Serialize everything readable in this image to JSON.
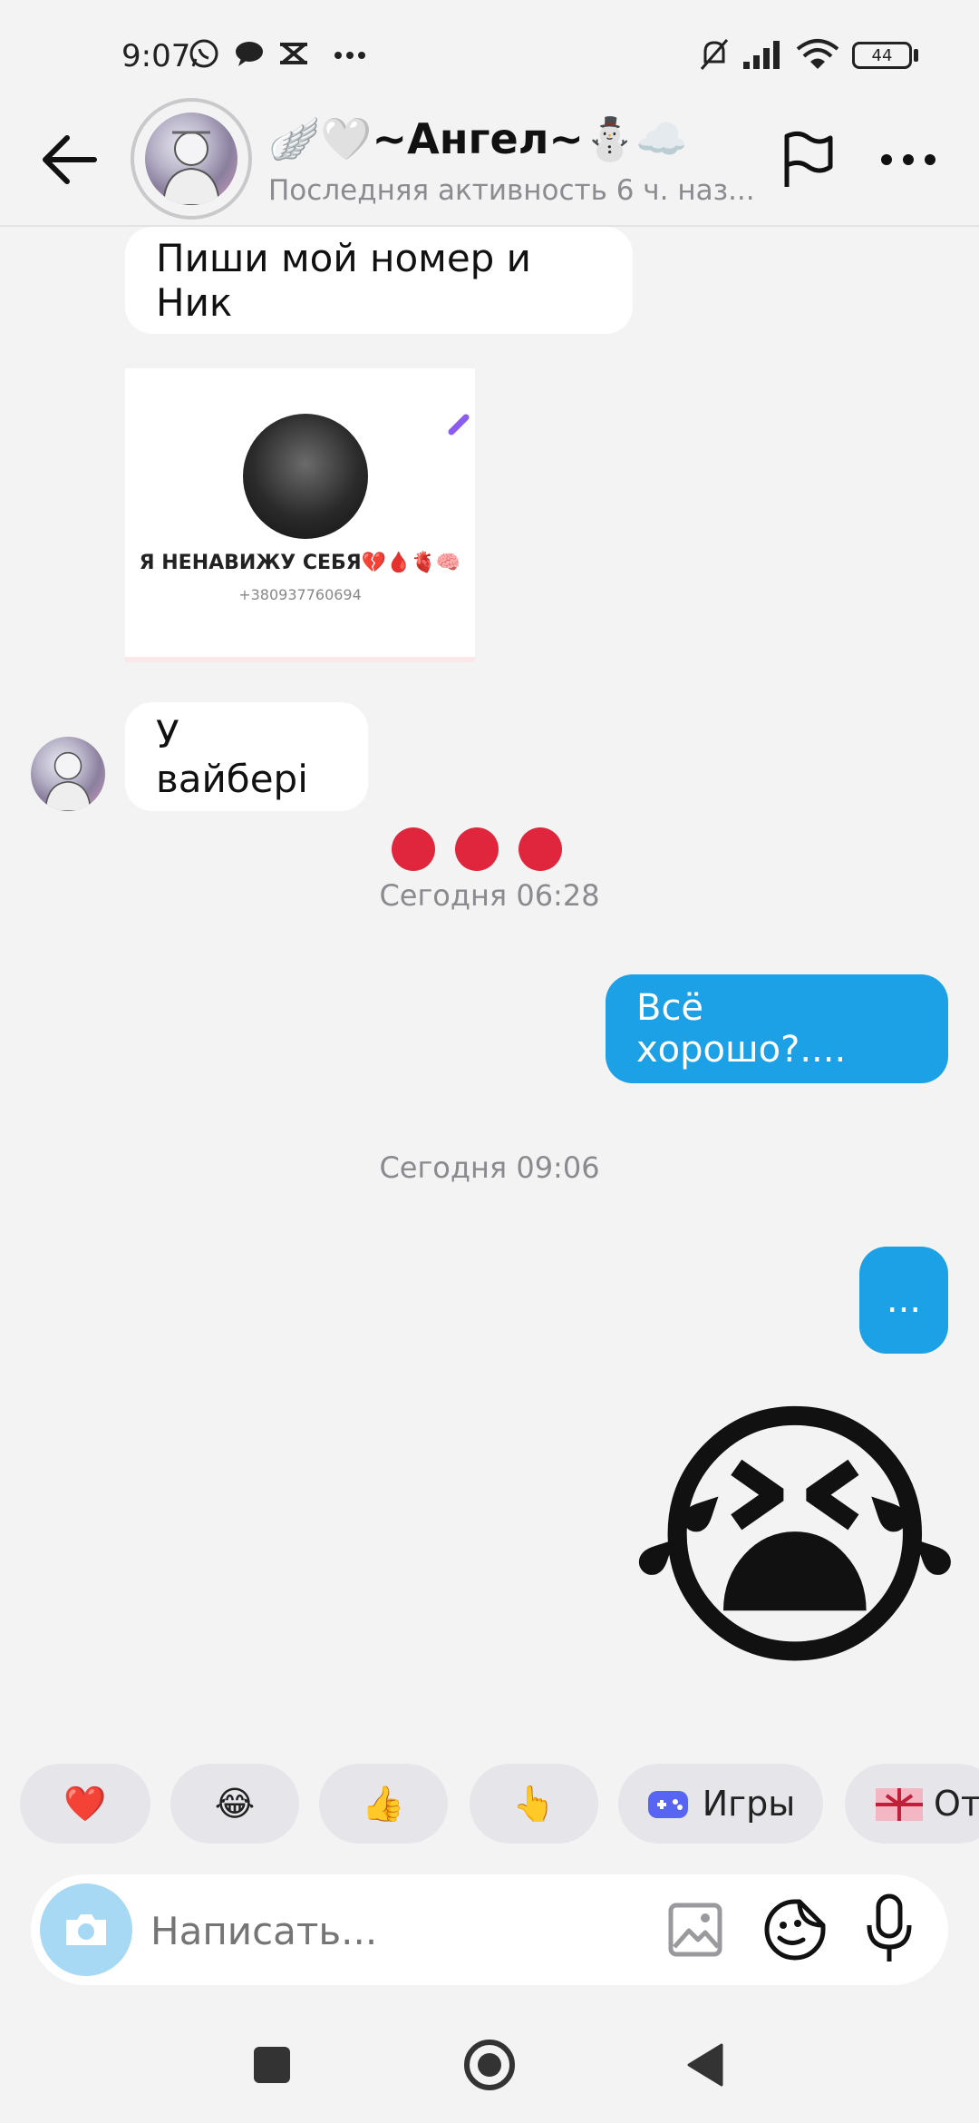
{
  "status_bar": {
    "time": "9:07",
    "battery": "44",
    "icons": [
      "whatsapp-icon",
      "chat-icon",
      "capcut-icon",
      "more-dots-icon",
      "mute-icon",
      "signal-icon",
      "wifi-icon",
      "battery-icon"
    ]
  },
  "header": {
    "title": "🪽🤍~Ангел~⛄☁️",
    "subtitle": "Последняя активность 6 ч. наз..."
  },
  "messages": {
    "incoming_1": "Пиши мой номер и Ник",
    "screenshot_name": "Я НЕНАВИЖУ СЕБЯ💔🩸🫀🧠",
    "screenshot_phone": "+380937760694",
    "incoming_2": "У вайбері",
    "time_1": "Сегодня 06:28",
    "outgoing_1": "Всё хорошо?....",
    "time_2": "Сегодня 09:06",
    "outgoing_2": "...",
    "sticker": "😭"
  },
  "quick_replies": [
    {
      "emoji": "❤️"
    },
    {
      "emoji": "😂"
    },
    {
      "emoji": "👍"
    },
    {
      "emoji": "👆"
    },
    {
      "label": "Игры"
    },
    {
      "label": "От"
    }
  ],
  "composer": {
    "placeholder": "Написать..."
  },
  "colors": {
    "accent": "#1da1e6",
    "dots": "#e0263c",
    "background": "#f3f3f4"
  }
}
